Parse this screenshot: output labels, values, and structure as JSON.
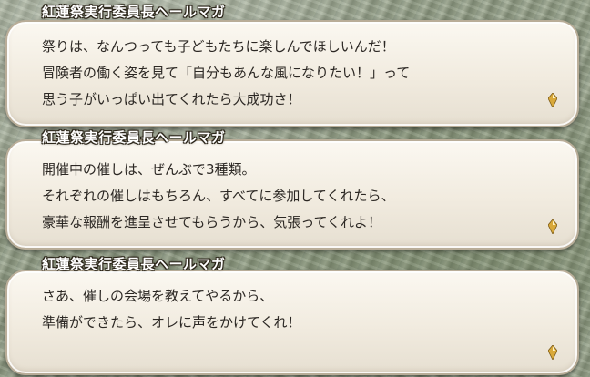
{
  "dialogs": [
    {
      "speaker": "紅蓮祭実行委員長ヘールマガ",
      "lines": [
        "祭りは、なんつっても子どもたちに楽しんでほしいんだ！",
        "冒険者の働く姿を見て「自分もあんな風になりたい！」って",
        "思う子がいっぱい出てくれたら大成功さ！"
      ],
      "cursor_icon": "advance-diamond-icon"
    },
    {
      "speaker": "紅蓮祭実行委員長ヘールマガ",
      "lines": [
        "開催中の催しは、ぜんぶで3種類。",
        "それぞれの催しはもちろん、すべてに参加してくれたら、",
        "豪華な報酬を進呈させてもらうから、気張ってくれよ！"
      ],
      "cursor_icon": "advance-diamond-icon"
    },
    {
      "speaker": "紅蓮祭実行委員長ヘールマガ",
      "lines": [
        "さあ、催しの会場を教えてやるから、",
        "準備ができたら、オレに声をかけてくれ！"
      ],
      "cursor_icon": "advance-diamond-icon"
    }
  ],
  "colors": {
    "speaker_text": "#ffffff",
    "speaker_outline": "#2a2418",
    "body_text": "#2c2824",
    "box_fill": "#f1ebdf",
    "cursor_gold": "#d9a93a"
  }
}
